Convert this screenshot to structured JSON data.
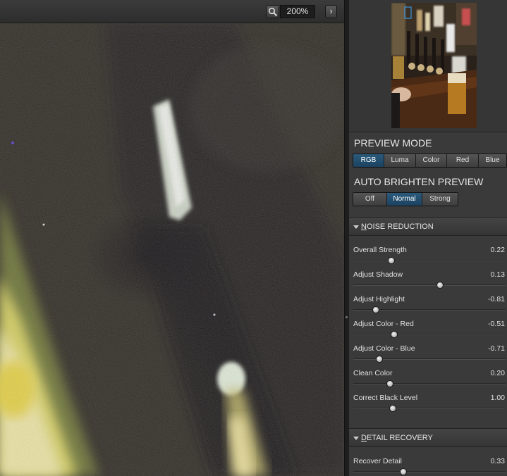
{
  "toolbar": {
    "zoom_icon": "magnifier-icon",
    "zoom_level": "200%",
    "next_icon": "chevron-right-icon",
    "next_glyph": "›"
  },
  "preview_mode": {
    "title": "PREVIEW MODE",
    "options": [
      "RGB",
      "Luma",
      "Color",
      "Red",
      "Blue"
    ],
    "selected": "RGB"
  },
  "auto_brighten": {
    "title": "AUTO BRIGHTEN PREVIEW",
    "options": [
      "Off",
      "Normal",
      "Strong"
    ],
    "selected": "Normal"
  },
  "noise_reduction": {
    "header_first": "N",
    "header_rest": "OISE REDUCTION",
    "sliders": [
      {
        "label": "Overall Strength",
        "value": "0.22",
        "position": 0.25
      },
      {
        "label": "Adjust Shadow",
        "value": "0.13",
        "position": 0.57
      },
      {
        "label": "Adjust Highlight",
        "value": "-0.81",
        "position": 0.15
      },
      {
        "label": "Adjust Color - Red",
        "value": "-0.51",
        "position": 0.27
      },
      {
        "label": "Adjust Color - Blue",
        "value": "-0.71",
        "position": 0.17
      },
      {
        "label": "Clean Color",
        "value": "0.20",
        "position": 0.24
      },
      {
        "label": "Correct Black Level",
        "value": "1.00",
        "position": 0.26
      }
    ]
  },
  "detail_recovery": {
    "header_first": "D",
    "header_rest": "ETAIL RECOVERY",
    "sliders": [
      {
        "label": "Recover Detail",
        "value": "0.33",
        "position": 0.33
      }
    ]
  },
  "colors": {
    "accent": "#1e4a6b",
    "panel": "#3a3a3a",
    "text": "#e0e0e0"
  }
}
